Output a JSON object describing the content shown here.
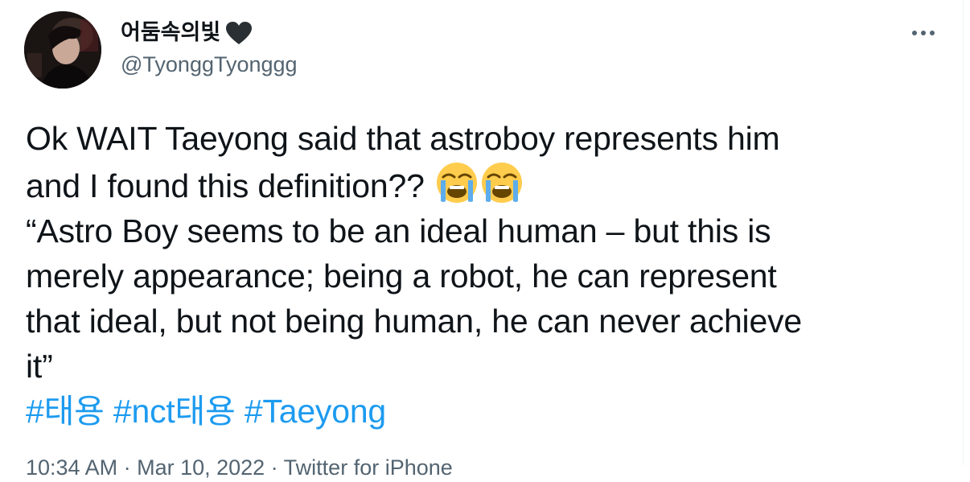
{
  "tweet": {
    "author": {
      "display_name": "어둠속의빛",
      "handle": "@TyonggTyonggg",
      "name_emoji": "black-heart-icon"
    },
    "more_label": "More",
    "text_lines": [
      "Ok WAIT Taeyong said that astroboy represents him",
      "and I found this definition??",
      "“Astro Boy seems to be an ideal human – but this is",
      "merely appearance; being a robot, he can represent",
      "that ideal, but not being human, he can never achieve",
      "it”"
    ],
    "emojis": [
      "loudly-crying-face-icon",
      "loudly-crying-face-icon"
    ],
    "hashtags": [
      "#태용",
      "#nct태용",
      "#Taeyong"
    ],
    "meta_partial": "10:34 AM · Mar 10, 2022 · Twitter for iPhone"
  },
  "colors": {
    "text": "#0f1419",
    "secondary": "#536471",
    "link": "#1d9bf0"
  }
}
